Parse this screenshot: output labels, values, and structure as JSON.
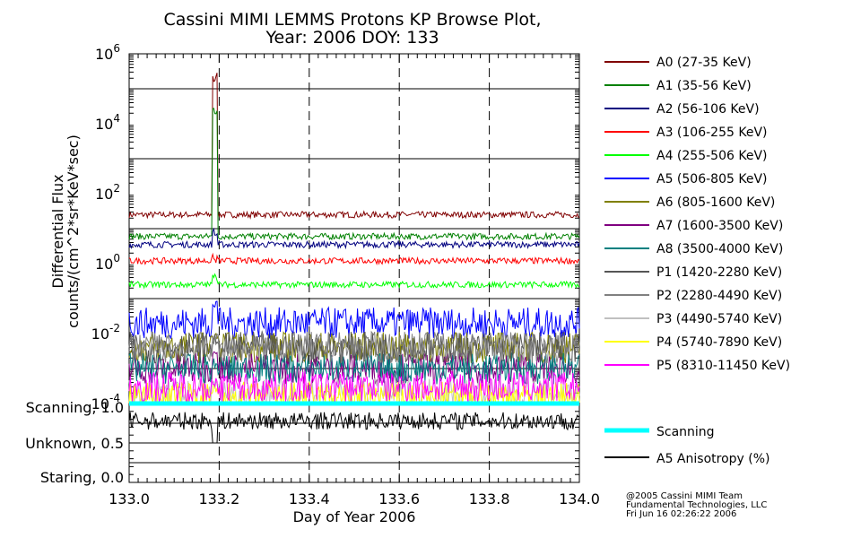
{
  "chart_data": {
    "type": "line",
    "title": "Cassini MIMI LEMMS Protons KP Browse Plot,",
    "subtitle": "Year: 2006 DOY: 133",
    "xlabel": "Day of Year 2006",
    "ylabel_line1": "Differential Flux",
    "ylabel_line2": "counts/(cm^2*sr*KeV*sec)",
    "xlim": [
      133.0,
      134.0
    ],
    "x_ticks": [
      "133.0",
      "133.2",
      "133.4",
      "133.6",
      "133.8",
      "134.0"
    ],
    "ylim": [
      0.0001,
      1000000
    ],
    "y_scale": "log",
    "y_ticks": [
      {
        "base": "10",
        "exp": "-4"
      },
      {
        "base": "10",
        "exp": "-2"
      },
      {
        "base": "10",
        "exp": "0"
      },
      {
        "base": "10",
        "exp": "2"
      },
      {
        "base": "10",
        "exp": "4"
      },
      {
        "base": "10",
        "exp": "6"
      }
    ],
    "grid": true,
    "legend_position": "right",
    "series": [
      {
        "name": "A0 (27-35 KeV)",
        "color": "#800000",
        "level": 25,
        "spike_peak": 300000
      },
      {
        "name": "A1 (35-56 KeV)",
        "color": "#008000",
        "level": 6,
        "spike_peak": 30000
      },
      {
        "name": "A2 (56-106 KeV)",
        "color": "#000080",
        "level": 3.5,
        "spike_peak": 10
      },
      {
        "name": "A3 (106-255 KeV)",
        "color": "#ff0000",
        "level": 1.2,
        "spike_peak": 2
      },
      {
        "name": "A4 (255-506 KeV)",
        "color": "#00ff00",
        "level": 0.25,
        "spike_peak": 0.5
      },
      {
        "name": "A5 (506-805 KeV)",
        "color": "#0000ff",
        "level": 0.02,
        "spike_peak": 0.1
      },
      {
        "name": "A6 (805-1600 KeV)",
        "color": "#808000",
        "level": 0.004,
        "spike_peak": 0.01
      },
      {
        "name": "A7 (1600-3500 KeV)",
        "color": "#800080",
        "level": 0.001,
        "spike_peak": 0.003
      },
      {
        "name": "A8 (3500-4000 KeV)",
        "color": "#008080",
        "level": 0.001,
        "spike_peak": 0.002
      },
      {
        "name": "P1 (1420-2280 KeV)",
        "color": "#555555",
        "level": 0.004,
        "spike_peak": 0.01
      },
      {
        "name": "P2 (2280-4490 KeV)",
        "color": "#808080",
        "level": 0.004,
        "spike_peak": 0.01
      },
      {
        "name": "P3 (4490-5740 KeV)",
        "color": "#c0c0c0",
        "level": 0.0002,
        "spike_peak": 0.0005
      },
      {
        "name": "P4 (5740-7890 KeV)",
        "color": "#ffff00",
        "level": 0.00015,
        "spike_peak": 0.0004
      },
      {
        "name": "P5 (8310-11450 KeV)",
        "color": "#ff00ff",
        "level": 0.0003,
        "spike_peak": 0.0006
      }
    ],
    "lower_panel": {
      "y_labels": [
        "Scanning, 1.0",
        "Unknown, 0.5",
        "Staring, 0.0"
      ],
      "ylim": [
        0.0,
        1.0
      ],
      "scanning": {
        "name": "Scanning",
        "color": "#00ffff",
        "value": 1.0
      },
      "anisotropy": {
        "name": "A5 Anisotropy (%)",
        "color": "#000000",
        "level": 0.78,
        "dip_value": 0.5
      }
    }
  },
  "footer": {
    "line1": "@2005 Cassini MIMI Team",
    "line2": "Fundamental Technologies, LLC",
    "line3": "Fri Jun 16 02:26:22 2006"
  }
}
